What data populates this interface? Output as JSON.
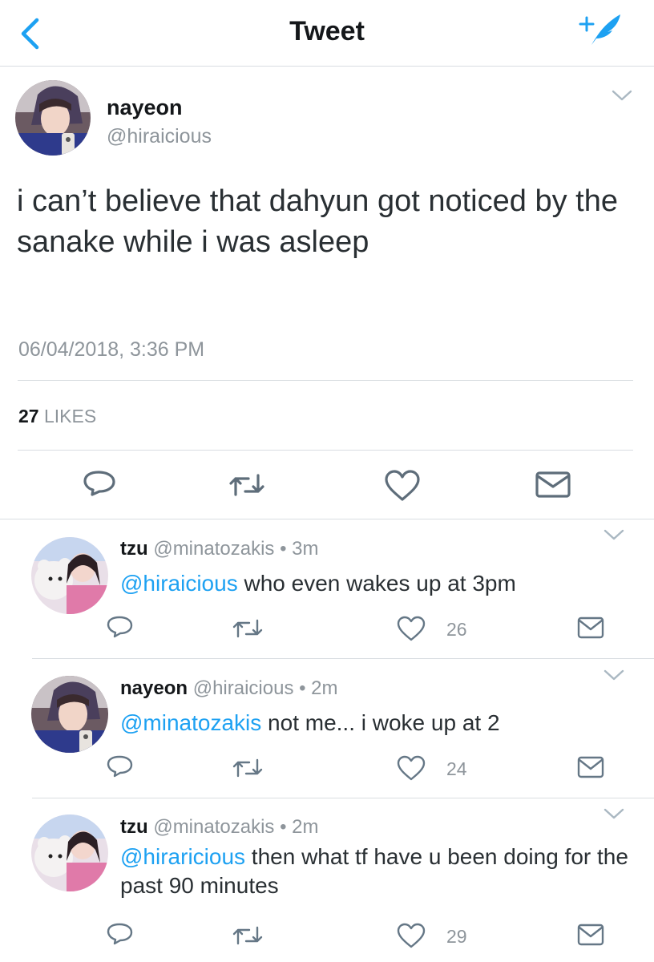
{
  "header": {
    "title": "Tweet"
  },
  "tweet": {
    "name": "nayeon",
    "handle": "@hiraicious",
    "text": "i can’t believe that dahyun got noticed by the sanake while i was asleep",
    "timestamp": "06/04/2018, 3:36 PM",
    "likes_count": "27",
    "likes_label": "LIKES"
  },
  "replies": [
    {
      "name": "tzu",
      "meta": "@minatozakis • 3m",
      "mention": "@hiraicious",
      "text": " who even wakes up at 3pm",
      "like_count": "26"
    },
    {
      "name": "nayeon",
      "meta": "@hiraicious • 2m",
      "mention": "@minatozakis",
      "text": " not me... i woke up at 2",
      "like_count": "24"
    },
    {
      "name": "tzu",
      "meta": "@minatozakis • 2m",
      "mention": "@hiraricious",
      "text": " then what tf have u been doing for the past 90 minutes",
      "like_count": "29"
    }
  ],
  "colors": {
    "accent": "#1da1f2",
    "text": "#14171a",
    "secondary": "#8e959b",
    "divider": "#d9dde1"
  },
  "icons": [
    "back-chevron-icon",
    "compose-tweet-icon",
    "chevron-down-icon",
    "reply-icon",
    "retweet-icon",
    "heart-icon",
    "envelope-icon"
  ]
}
